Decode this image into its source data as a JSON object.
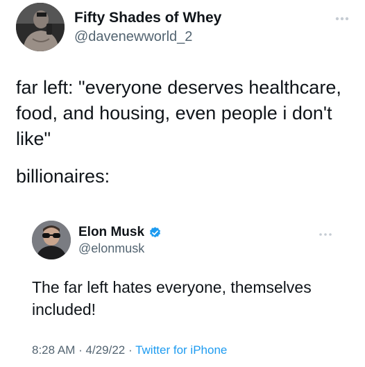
{
  "outer": {
    "display_name": "Fifty Shades of Whey",
    "handle": "@davenewworld_2",
    "text_line1": "far left: \"everyone deserves healthcare, food, and housing, even people i don't like\"",
    "text_line2": "billionaires:",
    "avatar_icon": "user-avatar-shirtless-man"
  },
  "quoted": {
    "display_name": "Elon Musk",
    "handle": "@elonmusk",
    "verified_icon": "verified-badge-icon",
    "text": "The far left hates everyone, themselves included!",
    "time": "8:28 AM",
    "date": "4/29/22",
    "separator": "·",
    "source": "Twitter for iPhone",
    "avatar_icon": "user-avatar-elon-musk"
  },
  "colors": {
    "text": "#0f1419",
    "secondary": "#536471",
    "accent": "#1d9bf0",
    "more_dots": "#c5ccd3"
  }
}
